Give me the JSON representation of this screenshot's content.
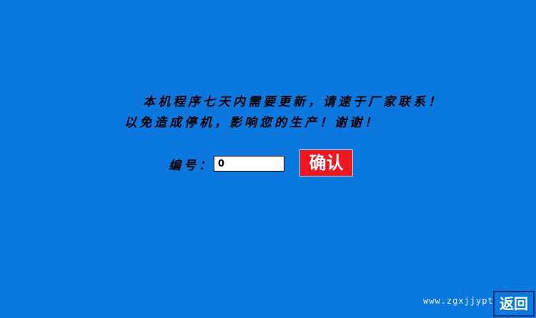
{
  "colors": {
    "background": "#0b78e0",
    "message_text": "#000000",
    "confirm_button_bg": "#f01820",
    "confirm_button_text": "#ffffff",
    "back_button_border": "#0a2e7a"
  },
  "notice": {
    "line1": "本机程序七天内需要更新，请速于厂家联系！",
    "line2": "以免造成停机，影响您的生产！谢谢！"
  },
  "form": {
    "serial_label": "编号：",
    "serial_value": "0",
    "confirm_label": "确认"
  },
  "watermark": "www.zgxjjypt.com",
  "back_label": "返回"
}
